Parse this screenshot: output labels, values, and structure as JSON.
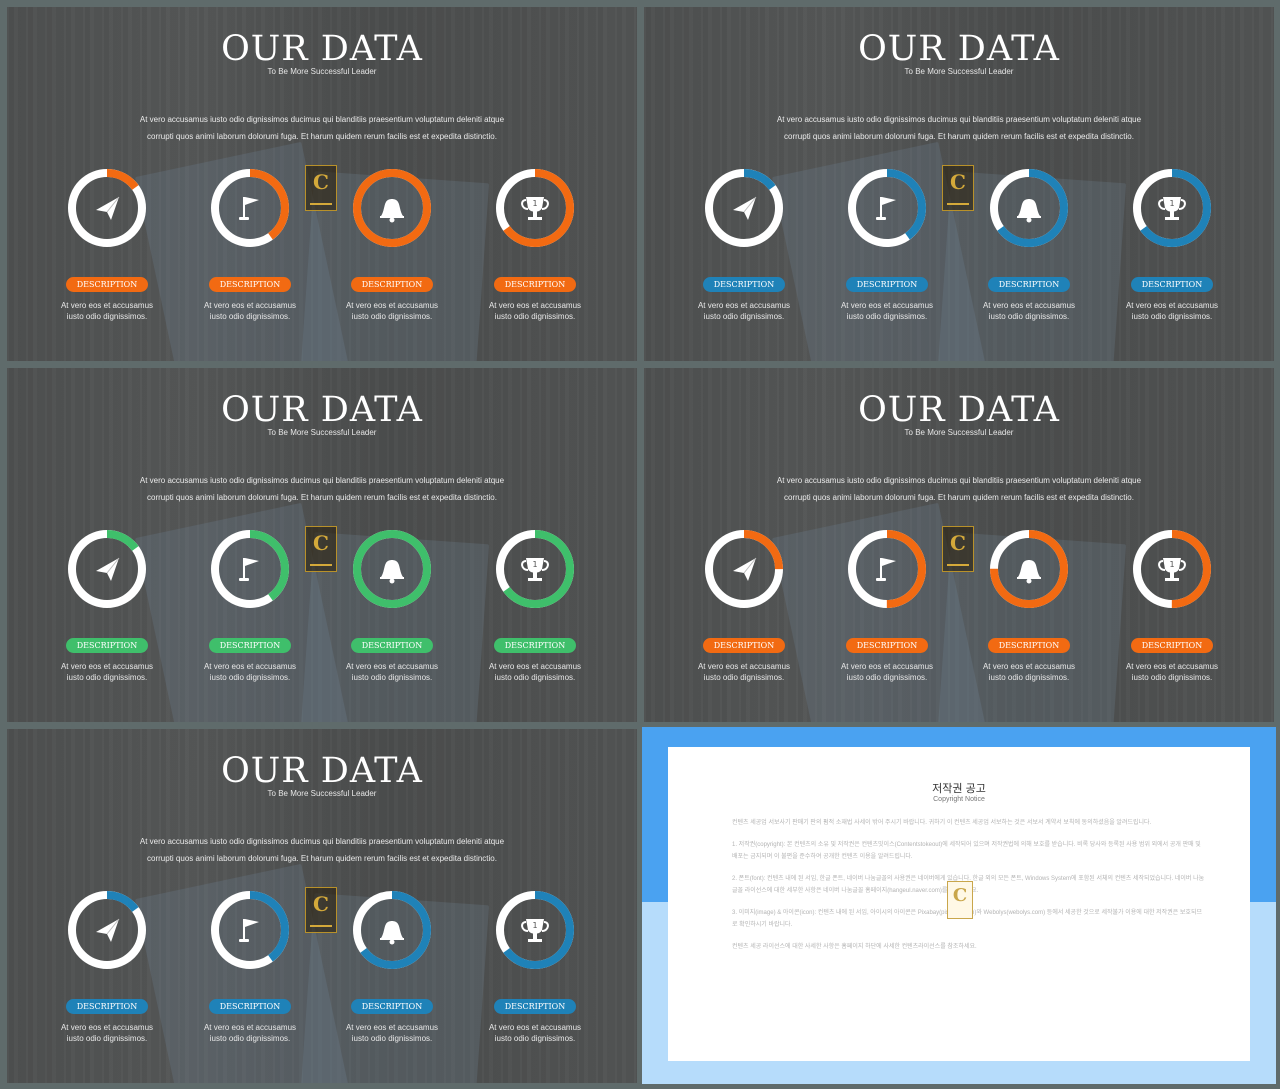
{
  "slide_common": {
    "title": "OUR DATA",
    "subtitle": "To Be More Successful Leader",
    "body_line1": "At vero accusamus iusto odio dignissimos ducimus qui blanditiis praesentium voluptatum deleniti atque",
    "body_line2": "corrupti quos animi laborum dolorumi fuga. Et harum quidem rerum facilis est et expedita distinctio.",
    "logo_letter": "C",
    "items": [
      {
        "icon": "paper-plane-icon",
        "label": "DESCRIPTION",
        "caption1": "At vero eos et accusamus",
        "caption2": "iusto odio dignissimos."
      },
      {
        "icon": "flag-icon",
        "label": "DESCRIPTION",
        "caption1": "At vero eos et accusamus",
        "caption2": "iusto odio dignissimos."
      },
      {
        "icon": "bell-icon",
        "label": "DESCRIPTION",
        "caption1": "At vero eos et accusamus",
        "caption2": "iusto odio dignissimos."
      },
      {
        "icon": "trophy-icon",
        "label": "DESCRIPTION",
        "caption1": "At vero eos et accusamus",
        "caption2": "iusto odio dignissimos."
      }
    ]
  },
  "slides": [
    {
      "accent": "#f26a12",
      "percents": [
        15,
        40,
        100,
        65
      ]
    },
    {
      "accent": "#1f82b8",
      "percents": [
        15,
        40,
        65,
        65
      ]
    },
    {
      "accent": "#3fbf6b",
      "percents": [
        15,
        40,
        100,
        65
      ]
    },
    {
      "accent": "#f26a12",
      "percents": [
        25,
        50,
        75,
        50
      ]
    },
    {
      "accent": "#1f82b8",
      "percents": [
        15,
        40,
        65,
        65
      ]
    }
  ],
  "notice": {
    "title": "저작권 공고",
    "subtitle": "Copyright Notice",
    "logo_letter": "C",
    "paragraphs": [
      "컨텐츠 세공업 서보사기 판매기 판의 펌적 소재법 사세이 밖어 주시기 바랍니다. 귀하기 이 컨텐츠 세공업 서보하는 것은 서보서 계약서 보칙에 동의하셨음을 알려드립니다.",
      "1. 저작권(copyright): 본 컨텐츠의 소유 및 저작권은 컨텐츠밋이스(Contentstokeout)에 세작되어 있으며 저작권법에 의해 보호를 받습니다. 비록 당사와 등록된 사용 범위 외에서 공개 판매 및 배포는 금지되며 이 불편을 준수하여 공개한 컨텐츠 이용을 알려드립니다.",
      "2. 폰트(font): 컨텐츠 내에 된 서임, 한글 폰트, 네이버 나눔글꼴의 사용권은 네이버에게 있습니다. 한글 외의 모든 폰트, Windows System에 포함된 서체의 컨텐츠 세작되었습니다. 네이버 나눔글꼴 라이선스에 대한 세부한 사항은 네이버 나눔글꼴 홈페이지(hangeul.naver.com)를 참조하세요.",
      "3. 이미지(image) & 아이콘(icon): 컨텐츠 내에 된 서임, 아이시의 아이콘은 Pixabay(pixabay.com)와 Webolys(webolys.com) 등에서 세공한 것으로 세작불가 이용에 대한 저작권은 보호되므로 확인하시기 바랍니다.",
      "컨텐츠 세공 라이선스에 대한 사세한 사항은 홈페이지 하단에 사세한 컨텐츠라이선스를 참조하세요."
    ]
  }
}
